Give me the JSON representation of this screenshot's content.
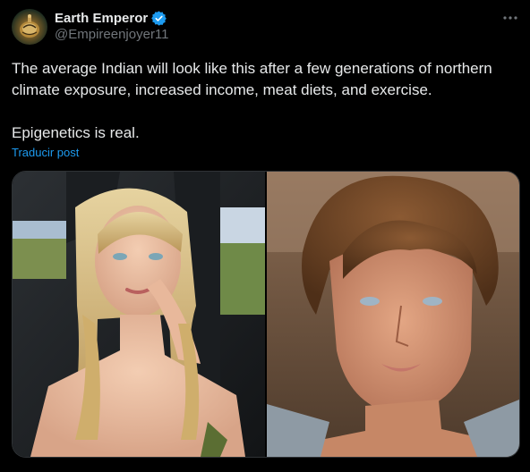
{
  "author": {
    "display_name": "Earth Emperor",
    "handle": "@Empireenjoyer11",
    "verified": true,
    "avatar_icon": "globe-avatar"
  },
  "tweet": {
    "paragraphs": [
      "The average Indian will look like this after a few generations of northern climate exposure, increased income, meat diets, and exercise.",
      "Epigenetics is real."
    ],
    "translate_label": "Traducir post"
  },
  "media": {
    "count": 2,
    "images": [
      {
        "subject": "woman-photo"
      },
      {
        "subject": "man-photo"
      }
    ]
  },
  "colors": {
    "background": "#000000",
    "text": "#e7e9ea",
    "secondary": "#71767b",
    "accent": "#1d9bf0",
    "border": "#2f3336"
  }
}
